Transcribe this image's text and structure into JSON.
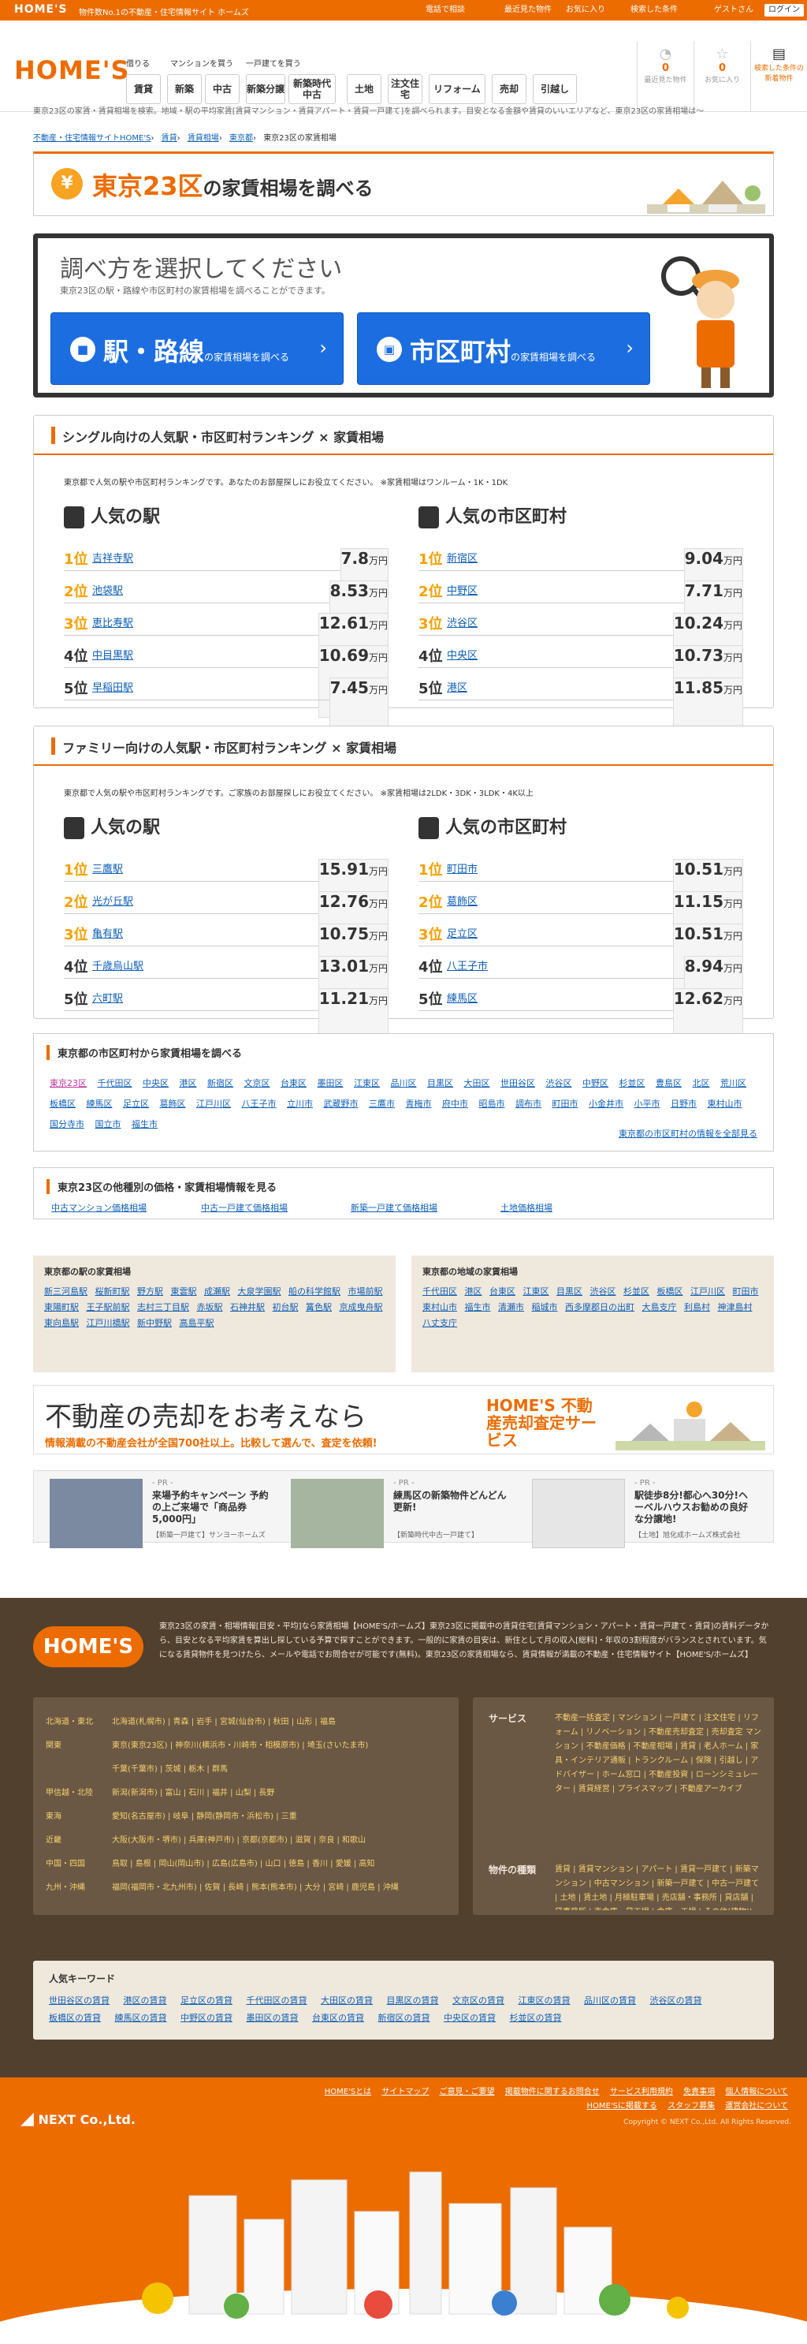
{
  "topbar": {
    "logo": "HOME'S",
    "tagline": "物件数No.1の不動産・住宅情報サイト ホームズ",
    "phone": "電話で相談",
    "recent": "最近見た物件",
    "fav": "お気に入り",
    "history": "検索した条件",
    "guest": "ゲストさん",
    "login": "ログイン"
  },
  "header": {
    "logo": "HOME'S",
    "groups": [
      "借りる",
      "マンションを買う",
      "一戸建てを買う"
    ],
    "nav": [
      "賃貸",
      "新築",
      "中古",
      "新築分譲",
      "新築時代中古",
      "土地",
      "注文住宅",
      "リフォーム",
      "売却",
      "引越し"
    ],
    "icons": [
      {
        "label": "最近見た物件",
        "count": "0"
      },
      {
        "label": "お気に入り",
        "count": "0"
      },
      {
        "label": "検索した条件の新着物件",
        "count": ""
      }
    ]
  },
  "notice": "東京23区の家賃・賃貸相場を検索。地域・駅の平均家賃[賃貸マンション・賃貸アパート・賃貸一戸建て]を調べられます。目安となる金額や賃貸のいいエリアなど、東京23区の家賃相場は～",
  "breadcrumb": [
    "不動産・住宅情報サイトHOME'S",
    "賃貸",
    "賃貸相場",
    "東京都",
    "東京23区の家賃相場"
  ],
  "title": {
    "pre": "東京23区",
    "mid": "の家賃相場",
    "post": "を調べる"
  },
  "select": {
    "heading": "調べ方を選択してください",
    "sub": "東京23区の駅・路線や市区町村の家賃相場を調べることができます。",
    "btn1": "駅・路線",
    "btn2": "市区町村",
    "btn_sub": "の家賃相場を調べる"
  },
  "single": {
    "title": "シングル向けの人気駅・市区町村ランキング × 家賃相場",
    "desc": "東京都で人気の駅や市区町村ランキングです。あなたのお部屋探しにお役立てください。 ※家賃相場はワンルーム・1K・1DK",
    "station_title": "人気の駅",
    "city_title": "人気の市区町村",
    "stations": [
      {
        "name": "吉祥寺駅",
        "price": "7.8"
      },
      {
        "name": "池袋駅",
        "price": "8.53"
      },
      {
        "name": "恵比寿駅",
        "price": "12.61"
      },
      {
        "name": "中目黒駅",
        "price": "10.69"
      },
      {
        "name": "早稲田駅",
        "price": "7.45"
      }
    ],
    "cities": [
      {
        "name": "新宿区",
        "price": "9.04"
      },
      {
        "name": "中野区",
        "price": "7.71"
      },
      {
        "name": "渋谷区",
        "price": "10.24"
      },
      {
        "name": "中央区",
        "price": "10.73"
      },
      {
        "name": "港区",
        "price": "11.85"
      }
    ]
  },
  "family": {
    "title": "ファミリー向けの人気駅・市区町村ランキング × 家賃相場",
    "desc": "東京都で人気の駅や市区町村ランキングです。ご家族のお部屋探しにお役立てください。 ※家賃相場は2LDK・3DK・3LDK・4K以上",
    "station_title": "人気の駅",
    "city_title": "人気の市区町村",
    "stations": [
      {
        "name": "三鷹駅",
        "price": "15.91"
      },
      {
        "name": "光が丘駅",
        "price": "12.76"
      },
      {
        "name": "亀有駅",
        "price": "10.75"
      },
      {
        "name": "千歳烏山駅",
        "price": "13.01"
      },
      {
        "name": "六町駅",
        "price": "11.21"
      }
    ],
    "cities": [
      {
        "name": "町田市",
        "price": "10.51"
      },
      {
        "name": "葛飾区",
        "price": "11.15"
      },
      {
        "name": "足立区",
        "price": "10.51"
      },
      {
        "name": "八王子市",
        "price": "8.94"
      },
      {
        "name": "練馬区",
        "price": "12.62"
      }
    ]
  },
  "rank_labels": [
    "1位",
    "2位",
    "3位",
    "4位",
    "5位"
  ],
  "unit": "万円",
  "areas": {
    "title": "東京都の市区町村から家賃相場を調べる",
    "list": [
      "東京23区",
      "千代田区",
      "中央区",
      "港区",
      "新宿区",
      "文京区",
      "台東区",
      "墨田区",
      "江東区",
      "品川区",
      "目黒区",
      "大田区",
      "世田谷区",
      "渋谷区",
      "中野区",
      "杉並区",
      "豊島区",
      "北区",
      "荒川区",
      "板橋区",
      "練馬区",
      "足立区",
      "葛飾区",
      "江戸川区",
      "八王子市",
      "立川市",
      "武蔵野市",
      "三鷹市",
      "青梅市",
      "府中市",
      "昭島市",
      "調布市",
      "町田市",
      "小金井市",
      "小平市",
      "日野市",
      "東村山市",
      "国分寺市",
      "国立市",
      "福生市"
    ],
    "more": "東京都の市区町村の情報を全部見る"
  },
  "other": {
    "title": "東京23区の他種別の価格・家賃相場情報を見る",
    "links": [
      "中古マンション価格相場",
      "中古一戸建て価格相場",
      "新築一戸建て価格相場",
      "土地価格相場"
    ]
  },
  "nearby_station": {
    "title": "東京都の駅の家賃相場",
    "list": [
      "新三河島駅",
      "桜新町駅",
      "野方駅",
      "東雲駅",
      "成瀬駅",
      "大泉学園駅",
      "船の科学館駅",
      "市場前駅",
      "東陽町駅",
      "王子駅前駅",
      "志村三丁目駅",
      "赤坂駅",
      "石神井駅",
      "初台駅",
      "篝色駅",
      "京成曳舟駅",
      "東向島駅",
      "江戸川橋駅",
      "新中野駅",
      "高島平駅"
    ]
  },
  "nearby_area": {
    "title": "東京都の地域の家賃相場",
    "list": [
      "千代田区",
      "港区",
      "台東区",
      "江東区",
      "目黒区",
      "渋谷区",
      "杉並区",
      "板橋区",
      "江戸川区",
      "町田市",
      "東村山市",
      "福生市",
      "清瀬市",
      "稲城市",
      "西多摩郡日の出町",
      "大島支庁",
      "利島村",
      "神津島村",
      "八丈支庁"
    ]
  },
  "banner": {
    "a": "不動産の売却をお考えなら",
    "b": "情報満載の不動産会社が全国700社以上。比較して選んで、査定を依頼!",
    "c": "HOME'S 不動産売却査定サービス"
  },
  "pr": [
    {
      "label": "- PR -",
      "title": "来場予約キャンペーン 予約の上ご来場で「商品券5,000円」",
      "sub": "【新築一戸建て】サンヨーホームズ"
    },
    {
      "label": "- PR -",
      "title": "練馬区の新築物件どんどん更新!",
      "sub": "【新築時代中古一戸建て】"
    },
    {
      "label": "- PR -",
      "title": "駅徒歩8分!都心へ30分!ヘーベルハウスお勧めの良好な分譲地!",
      "sub": "【土地】旭化成ホームズ株式会社"
    }
  ],
  "footer": {
    "logo": "HOME'S",
    "desc": "東京23区の家賃・相場情報[目安・平均]なら家賃相場【HOME'S/ホームズ】東京23区に掲載中の賃貸住宅[賃貸マンション・アパート・賃貸一戸建て・賃貸]の賃料データから、目安となる平均家賃を算出し探している予算で探すことができます。一般的に家賃の目安は、新住として月の収入[総料]・年収の3割程度がバランスとされています。気になる賃貸物件を見つけたら、メールや電話でお問合せが可能です(無料)。東京23区の家賃相場なら、賃貸情報が満載の不動産・住宅情報サイト【HOME'S/ホームズ】",
    "regions": [
      {
        "r": "北海道・東北",
        "l": "北海道(札幌市) | 青森 | 岩手 | 宮城(仙台市) | 秋田 | 山形 | 福島"
      },
      {
        "r": "関東",
        "l": "東京(東京23区) | 神奈川(横浜市・川崎市・相模原市) | 埼玉(さいたま市)"
      },
      {
        "r": "",
        "l": "千葉(千葉市) | 茨城 | 栃木 | 群馬"
      },
      {
        "r": "甲信越・北陸",
        "l": "新潟(新潟市) | 富山 | 石川 | 福井 | 山梨 | 長野"
      },
      {
        "r": "東海",
        "l": "愛知(名古屋市) | 岐阜 | 静岡(静岡市・浜松市) | 三重"
      },
      {
        "r": "近畿",
        "l": "大阪(大阪市・堺市) | 兵庫(神戸市) | 京都(京都市) | 滋賀 | 奈良 | 和歌山"
      },
      {
        "r": "中国・四国",
        "l": "鳥取 | 島根 | 岡山(岡山市) | 広島(広島市) | 山口 | 徳島 | 香川 | 愛媛 | 高知"
      },
      {
        "r": "九州・沖縄",
        "l": "福岡(福岡市・北九州市) | 佐賀 | 長崎 | 熊本(熊本市) | 大分 | 宮崎 | 鹿児島 | 沖縄"
      }
    ],
    "service_title": "サービス",
    "service": "不動産一括査定 | マンション | 一戸建て | 注文住宅 | リフォーム | リノベーション | 不動産売却査定 | 売却査定 マンション | 不動産価格 | 不動産相場 | 賃貸 | 老人ホーム | 家具・インテリア通販 | トランクルーム | 保険 | 引越し | アドバイザー | ホーム窓口 | 不動産投資 | ローンシミュレーター | 賃貸経営 | プライスマップ | 不動産アーカイブ",
    "types_title": "物件の種類",
    "types": "賃貸 | 賃貸マンション | アパート | 賃貸一戸建て | 新築マンション | 中古マンション | 新築一戸建て | 中古一戸建て | 土地 | 賃土地 | 月極駐車場 | 売店舗・事務所 | 貸店舗 | 貸事務所 | 売倉庫・貸工場 | 倉庫・工場 | その他(建物)| その他"
  },
  "keywords": {
    "title": "人気キーワード",
    "list": [
      "世田谷区の賃貸",
      "港区の賃貸",
      "足立区の賃貸",
      "千代田区の賃貸",
      "大田区の賃貸",
      "目黒区の賃貸",
      "文京区の賃貸",
      "江東区の賃貸",
      "品川区の賃貸",
      "渋谷区の賃貸",
      "板橋区の賃貸",
      "練馬区の賃貸",
      "中野区の賃貸",
      "墨田区の賃貸",
      "台東区の賃貸",
      "新宿区の賃貸",
      "中央区の賃貸",
      "杉並区の賃貸"
    ]
  },
  "bottom": {
    "company": "NEXT Co.,Ltd.",
    "links": [
      "HOME'Sとは",
      "サイトマップ",
      "ご意見・ご要望",
      "掲載物件に関するお問合せ",
      "サービス利用規約",
      "免責事項",
      "個人情報について",
      "HOME'Sに掲載する",
      "スタッフ募集",
      "運営会社について"
    ],
    "copy": "Copyright © NEXT Co.,Ltd. All Rights Reserved."
  }
}
